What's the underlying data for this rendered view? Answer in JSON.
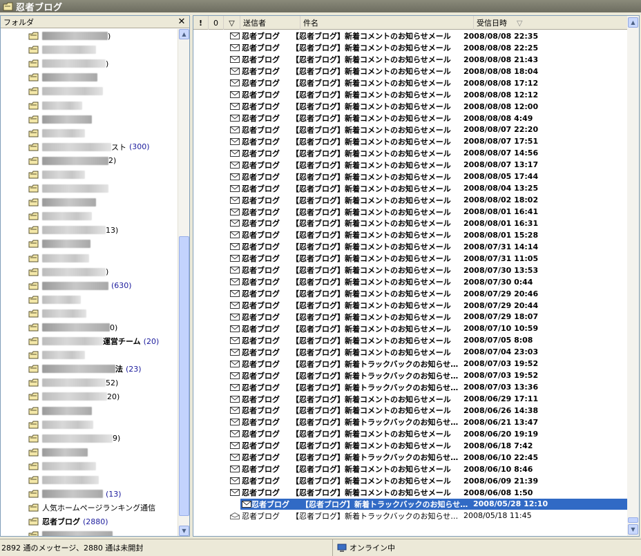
{
  "window": {
    "title": "忍者ブログ"
  },
  "folder_pane": {
    "header": "フォルダ",
    "items": [
      {
        "text": ")",
        "count": "",
        "blur": 95
      },
      {
        "text": "",
        "count": "",
        "blur": 78
      },
      {
        "text": ")",
        "count": "",
        "blur": 92
      },
      {
        "text": "",
        "count": "",
        "blur": 80
      },
      {
        "text": "",
        "count": "",
        "blur": 88
      },
      {
        "text": "",
        "count": "",
        "blur": 58
      },
      {
        "text": "",
        "count": "",
        "blur": 72
      },
      {
        "text": "",
        "count": "",
        "blur": 62
      },
      {
        "text": "スト",
        "count": "(300)",
        "blur": 100
      },
      {
        "text": "2)",
        "count": "",
        "blur": 96
      },
      {
        "text": "",
        "count": "",
        "blur": 62
      },
      {
        "text": "",
        "count": "",
        "blur": 96
      },
      {
        "text": "",
        "count": "",
        "blur": 78
      },
      {
        "text": "",
        "count": "",
        "blur": 72
      },
      {
        "text": "13)",
        "count": "",
        "blur": 92
      },
      {
        "text": "",
        "count": "",
        "blur": 70
      },
      {
        "text": "",
        "count": "",
        "blur": 68
      },
      {
        "text": ")",
        "count": "",
        "blur": 92
      },
      {
        "text": "",
        "count": "(630)",
        "blur": 96
      },
      {
        "text": "",
        "count": "",
        "blur": 56
      },
      {
        "text": "",
        "count": "",
        "blur": 64
      },
      {
        "text": "0)",
        "count": "",
        "blur": 98
      },
      {
        "text": "運営チーム",
        "count": "(20)",
        "blur": 88,
        "bold": true
      },
      {
        "text": "",
        "count": "",
        "blur": 62
      },
      {
        "text": "法",
        "count": "(23)",
        "blur": 106,
        "bold": true
      },
      {
        "text": "52)",
        "count": "",
        "blur": 92
      },
      {
        "text": "20)",
        "count": "",
        "blur": 94
      },
      {
        "text": "",
        "count": "",
        "blur": 72
      },
      {
        "text": "",
        "count": "",
        "blur": 74
      },
      {
        "text": "9)",
        "count": "",
        "blur": 102
      },
      {
        "text": "",
        "count": "",
        "blur": 66
      },
      {
        "text": "",
        "count": "",
        "blur": 78
      },
      {
        "text": "",
        "count": "",
        "blur": 82
      },
      {
        "text": "",
        "count": "(13)",
        "blur": 88
      },
      {
        "text": "人気ホームページランキング通信",
        "count": "",
        "blur": 0
      },
      {
        "text": "忍者ブログ",
        "count": "(2880)",
        "blur": 0,
        "bold": true
      },
      {
        "text": "",
        "count": "",
        "blur": 102
      }
    ]
  },
  "message_pane": {
    "columns": {
      "importance": "!",
      "attachment": "0",
      "flag": "▽",
      "sender": "送信者",
      "subject": "件名",
      "received": "受信日時",
      "sort_icon": "▽"
    },
    "rows": [
      {
        "sender": "忍者ブログ",
        "subject": "【忍者ブログ】新着コメントのお知らせメール",
        "date": "2008/08/08 22:35"
      },
      {
        "sender": "忍者ブログ",
        "subject": "【忍者ブログ】新着コメントのお知らせメール",
        "date": "2008/08/08 22:25"
      },
      {
        "sender": "忍者ブログ",
        "subject": "【忍者ブログ】新着コメントのお知らせメール",
        "date": "2008/08/08 21:43"
      },
      {
        "sender": "忍者ブログ",
        "subject": "【忍者ブログ】新着コメントのお知らせメール",
        "date": "2008/08/08 18:04"
      },
      {
        "sender": "忍者ブログ",
        "subject": "【忍者ブログ】新着コメントのお知らせメール",
        "date": "2008/08/08 17:12"
      },
      {
        "sender": "忍者ブログ",
        "subject": "【忍者ブログ】新着コメントのお知らせメール",
        "date": "2008/08/08 12:12"
      },
      {
        "sender": "忍者ブログ",
        "subject": "【忍者ブログ】新着コメントのお知らせメール",
        "date": "2008/08/08 12:00"
      },
      {
        "sender": "忍者ブログ",
        "subject": "【忍者ブログ】新着コメントのお知らせメール",
        "date": "2008/08/08 4:49"
      },
      {
        "sender": "忍者ブログ",
        "subject": "【忍者ブログ】新着コメントのお知らせメール",
        "date": "2008/08/07 22:20"
      },
      {
        "sender": "忍者ブログ",
        "subject": "【忍者ブログ】新着コメントのお知らせメール",
        "date": "2008/08/07 17:51"
      },
      {
        "sender": "忍者ブログ",
        "subject": "【忍者ブログ】新着コメントのお知らせメール",
        "date": "2008/08/07 14:56"
      },
      {
        "sender": "忍者ブログ",
        "subject": "【忍者ブログ】新着コメントのお知らせメール",
        "date": "2008/08/07 13:17"
      },
      {
        "sender": "忍者ブログ",
        "subject": "【忍者ブログ】新着コメントのお知らせメール",
        "date": "2008/08/05 17:44"
      },
      {
        "sender": "忍者ブログ",
        "subject": "【忍者ブログ】新着コメントのお知らせメール",
        "date": "2008/08/04 13:25"
      },
      {
        "sender": "忍者ブログ",
        "subject": "【忍者ブログ】新着コメントのお知らせメール",
        "date": "2008/08/02 18:02"
      },
      {
        "sender": "忍者ブログ",
        "subject": "【忍者ブログ】新着コメントのお知らせメール",
        "date": "2008/08/01 16:41"
      },
      {
        "sender": "忍者ブログ",
        "subject": "【忍者ブログ】新着コメントのお知らせメール",
        "date": "2008/08/01 16:31"
      },
      {
        "sender": "忍者ブログ",
        "subject": "【忍者ブログ】新着コメントのお知らせメール",
        "date": "2008/08/01 15:28"
      },
      {
        "sender": "忍者ブログ",
        "subject": "【忍者ブログ】新着コメントのお知らせメール",
        "date": "2008/07/31 14:14"
      },
      {
        "sender": "忍者ブログ",
        "subject": "【忍者ブログ】新着コメントのお知らせメール",
        "date": "2008/07/31 11:05"
      },
      {
        "sender": "忍者ブログ",
        "subject": "【忍者ブログ】新着コメントのお知らせメール",
        "date": "2008/07/30 13:53"
      },
      {
        "sender": "忍者ブログ",
        "subject": "【忍者ブログ】新着コメントのお知らせメール",
        "date": "2008/07/30 0:44"
      },
      {
        "sender": "忍者ブログ",
        "subject": "【忍者ブログ】新着コメントのお知らせメール",
        "date": "2008/07/29 20:46"
      },
      {
        "sender": "忍者ブログ",
        "subject": "【忍者ブログ】新着コメントのお知らせメール",
        "date": "2008/07/29 20:44"
      },
      {
        "sender": "忍者ブログ",
        "subject": "【忍者ブログ】新着コメントのお知らせメール",
        "date": "2008/07/29 18:07"
      },
      {
        "sender": "忍者ブログ",
        "subject": "【忍者ブログ】新着コメントのお知らせメール",
        "date": "2008/07/10 10:59"
      },
      {
        "sender": "忍者ブログ",
        "subject": "【忍者ブログ】新着コメントのお知らせメール",
        "date": "2008/07/05 8:08"
      },
      {
        "sender": "忍者ブログ",
        "subject": "【忍者ブログ】新着コメントのお知らせメール",
        "date": "2008/07/04 23:03"
      },
      {
        "sender": "忍者ブログ",
        "subject": "【忍者ブログ】新着トラックバックのお知らせメ...",
        "date": "2008/07/03 19:52"
      },
      {
        "sender": "忍者ブログ",
        "subject": "【忍者ブログ】新着トラックバックのお知らせメ...",
        "date": "2008/07/03 19:52"
      },
      {
        "sender": "忍者ブログ",
        "subject": "【忍者ブログ】新着トラックバックのお知らせメ...",
        "date": "2008/07/03 13:36"
      },
      {
        "sender": "忍者ブログ",
        "subject": "【忍者ブログ】新着コメントのお知らせメール",
        "date": "2008/06/29 17:11"
      },
      {
        "sender": "忍者ブログ",
        "subject": "【忍者ブログ】新着コメントのお知らせメール",
        "date": "2008/06/26 14:38"
      },
      {
        "sender": "忍者ブログ",
        "subject": "【忍者ブログ】新着トラックバックのお知らせメ...",
        "date": "2008/06/21 13:47"
      },
      {
        "sender": "忍者ブログ",
        "subject": "【忍者ブログ】新着コメントのお知らせメール",
        "date": "2008/06/20 19:19"
      },
      {
        "sender": "忍者ブログ",
        "subject": "【忍者ブログ】新着コメントのお知らせメール",
        "date": "2008/06/18 7:42"
      },
      {
        "sender": "忍者ブログ",
        "subject": "【忍者ブログ】新着トラックバックのお知らせメ...",
        "date": "2008/06/10 22:45"
      },
      {
        "sender": "忍者ブログ",
        "subject": "【忍者ブログ】新着コメントのお知らせメール",
        "date": "2008/06/10 8:46"
      },
      {
        "sender": "忍者ブログ",
        "subject": "【忍者ブログ】新着コメントのお知らせメール",
        "date": "2008/06/09 21:39"
      },
      {
        "sender": "忍者ブログ",
        "subject": "【忍者ブログ】新着コメントのお知らせメール",
        "date": "2008/06/08 1:50"
      },
      {
        "sender": "忍者ブログ",
        "subject": "【忍者ブログ】新着トラックバックのお知らせメ...",
        "date": "2008/05/28 12:10",
        "selected": true
      },
      {
        "sender": "忍者ブログ",
        "subject": "【忍者ブログ】新着トラックバックのお知らせメール",
        "date": "2008/05/18 11:45",
        "read": true
      }
    ]
  },
  "status_bar": {
    "message_count": "2892 通のメッセージ、2880 通は未開封",
    "connection": "オンライン中"
  },
  "colors": {
    "selection": "#316ac5",
    "count_text": "#1a1a9c"
  }
}
